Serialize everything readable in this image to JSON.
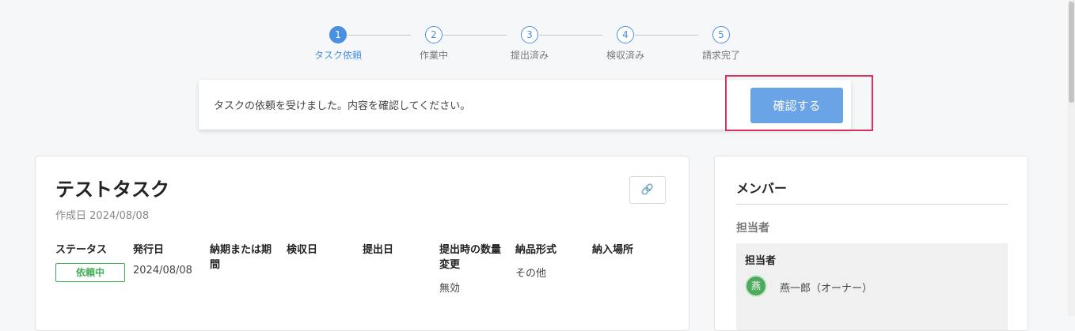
{
  "stepper": {
    "steps": [
      {
        "number": "1",
        "label": "タスク依頼"
      },
      {
        "number": "2",
        "label": "作業中"
      },
      {
        "number": "3",
        "label": "提出済み"
      },
      {
        "number": "4",
        "label": "検収済み"
      },
      {
        "number": "5",
        "label": "請求完了"
      }
    ],
    "active_index": 0
  },
  "notice": {
    "message": "タスクの依頼を受けました。内容を確認してください。",
    "confirm_label": "確認する"
  },
  "task": {
    "title": "テストタスク",
    "created_label": "作成日",
    "created_date": "2024/08/08",
    "link_icon": "🔗",
    "fields": [
      {
        "label": "ステータス",
        "value": "依頼中"
      },
      {
        "label": "発行日",
        "value": "2024/08/08"
      },
      {
        "label": "納期または期間",
        "value": ""
      },
      {
        "label": "検収日",
        "value": ""
      },
      {
        "label": "提出日",
        "value": ""
      },
      {
        "label": "提出時の数量変更",
        "value": "無効"
      },
      {
        "label": "納品形式",
        "value": "その他"
      },
      {
        "label": "納入場所",
        "value": ""
      }
    ]
  },
  "members": {
    "title": "メンバー",
    "assignee_heading": "担当者",
    "assignee_sub": "担当者",
    "avatar_char": "燕",
    "member_name": "燕一郎（オーナー）"
  },
  "colors": {
    "accent": "#4a8fe0",
    "button": "#6aa3e6",
    "status": "#3fae55",
    "highlight": "#d9305c"
  }
}
